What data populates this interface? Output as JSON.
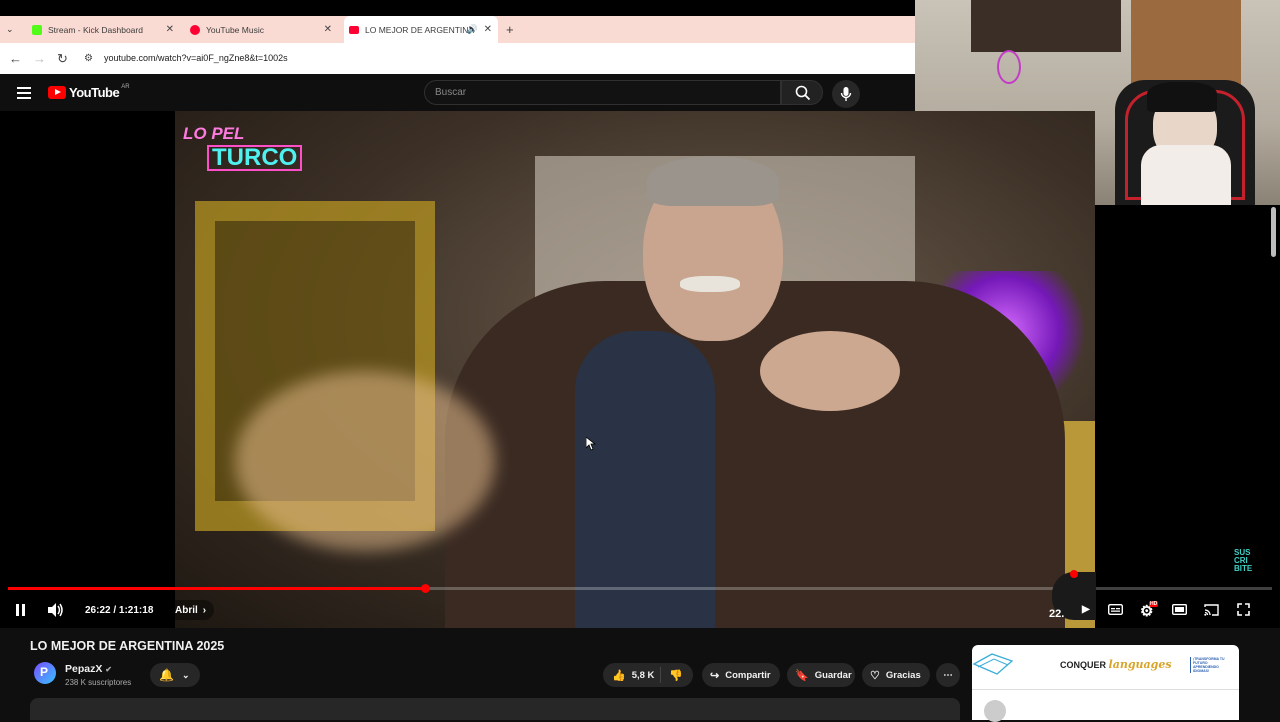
{
  "browser": {
    "tabs": [
      {
        "title": "Stream - Kick Dashboard",
        "color": "#53fc18"
      },
      {
        "title": "YouTube Music",
        "color": "#ff0033"
      },
      {
        "title": "LO MEJOR DE ARGENTINA",
        "color": "#ff0033",
        "active": true
      }
    ],
    "url": "youtube.com/watch?v=ai0F_ngZne8&t=1002s"
  },
  "youtube": {
    "logo_text": "YouTube",
    "region": "AR",
    "search_placeholder": "Buscar",
    "overlay_logo": {
      "line1": "LO PEL",
      "line2": "TURCO"
    },
    "subscribe_watermark": "SUS CRI BITE",
    "player": {
      "time": "26:22 / 1:21:18",
      "chapter": "Abril",
      "progress": 0.33,
      "corner_number": "22."
    },
    "video": {
      "title": "LO MEJOR DE ARGENTINA 2025",
      "channel": "PepazX",
      "subscribers": "238 K suscriptores",
      "likes": "5,8 K",
      "share": "Compartir",
      "save": "Guardar",
      "thanks": "Gracias"
    },
    "ad": {
      "brand": "CONQUER",
      "brand_italic": "languages",
      "tagline": "¡TRANSFORMA TU FUTURO APRENDIENDO IDIOMAS!"
    }
  },
  "colors": {
    "accent": "#ff0000",
    "bg": "#0f0f0f",
    "tabbar": "#fadbd3"
  }
}
